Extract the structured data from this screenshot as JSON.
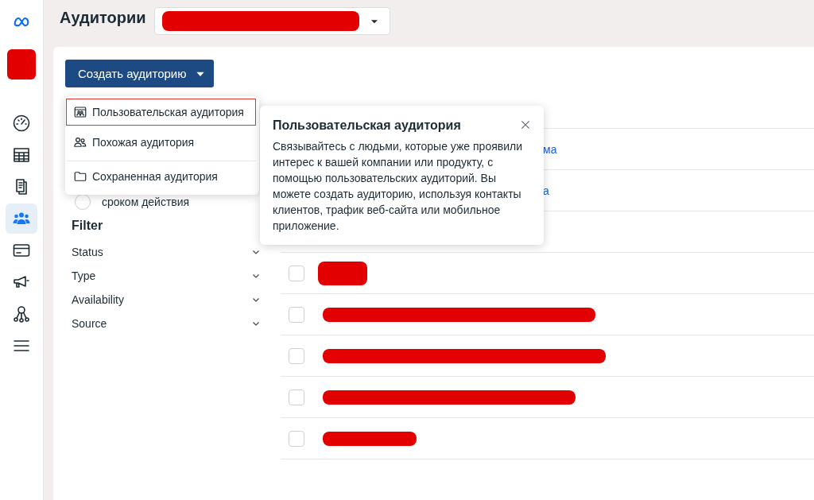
{
  "nav_items": [
    {
      "kind": "dashboard",
      "selected": false
    },
    {
      "kind": "table",
      "selected": false
    },
    {
      "kind": "pages",
      "selected": false
    },
    {
      "kind": "people",
      "selected": true
    },
    {
      "kind": "card",
      "selected": false
    },
    {
      "kind": "megaphone",
      "selected": false
    },
    {
      "kind": "network",
      "selected": false
    },
    {
      "kind": "menu",
      "selected": false
    }
  ],
  "header": {
    "title": "Аудитории"
  },
  "create_button": {
    "label": "Создать аудиторию"
  },
  "create_menu": {
    "items": [
      {
        "kind": "custom",
        "label": "Пользовательская аудитория",
        "selected": true
      },
      {
        "kind": "lookalike",
        "label": "Похожая аудитория",
        "selected": false
      },
      {
        "kind": "saved",
        "label": "Сохраненная аудитория",
        "selected": false
      }
    ]
  },
  "partial_option": {
    "label": "сроком действия",
    "selected": false
  },
  "filter": {
    "title": "Filter",
    "items": [
      {
        "label": "Status",
        "expanded": false
      },
      {
        "label": "Type",
        "expanded": false
      },
      {
        "label": "Availability",
        "expanded": false
      },
      {
        "label": "Source",
        "expanded": false
      }
    ]
  },
  "tooltip": {
    "title": "Пользовательская аудитория",
    "text": "Связывайтесь с людьми, которые уже проявили интерес к вашей компании или продукту, с помощью пользовательских аудиторий. Вы можете создать аудиторию, используя контакты клиентов, трафик веб-сайта или мобильное приложение."
  },
  "table": {
    "rows": [
      {
        "kind": "covered",
        "text": "ма"
      },
      {
        "kind": "covered",
        "text": "а"
      },
      {
        "kind": "hidden"
      },
      {
        "kind": "redacted",
        "checked": false
      },
      {
        "kind": "redacted",
        "checked": false
      },
      {
        "kind": "redacted",
        "checked": false
      },
      {
        "kind": "redacted",
        "checked": false
      },
      {
        "kind": "redacted",
        "checked": false
      }
    ]
  }
}
